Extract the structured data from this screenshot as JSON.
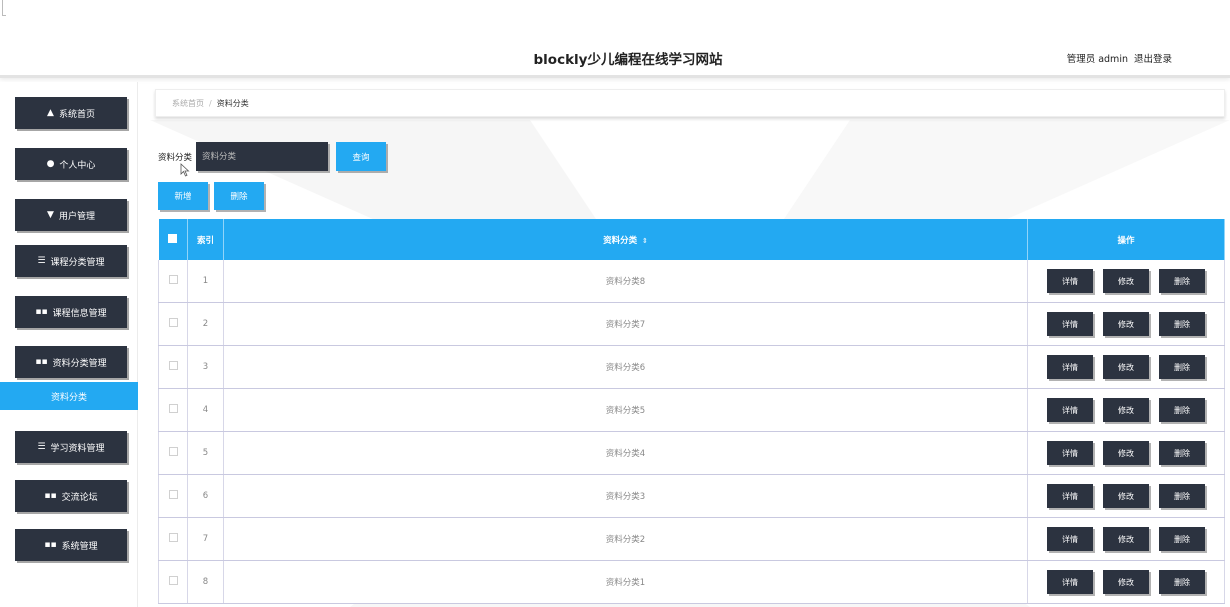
{
  "header": {
    "title": "blockly少儿编程在线学习网站",
    "user_label": "管理员 admin",
    "logout_label": "退出登录"
  },
  "sidebar": {
    "items": [
      {
        "label": "系统首页",
        "icon": "home-icon",
        "glyph": "▲"
      },
      {
        "label": "个人中心",
        "icon": "user-icon",
        "glyph": "●"
      },
      {
        "label": "用户管理",
        "icon": "user-manage-icon",
        "glyph": "▼"
      },
      {
        "label": "课程分类管理",
        "icon": "list-icon",
        "glyph": "☰"
      },
      {
        "label": "课程信息管理",
        "icon": "grid-icon",
        "glyph": "▪▪"
      },
      {
        "label": "资料分类管理",
        "icon": "grid-icon",
        "glyph": "▪▪"
      },
      {
        "label": "学习资料管理",
        "icon": "list-icon",
        "glyph": "☰"
      },
      {
        "label": "交流论坛",
        "icon": "grid-icon",
        "glyph": "▪▪"
      },
      {
        "label": "系统管理",
        "icon": "grid-icon",
        "glyph": "▪▪"
      }
    ],
    "active_sub": "资料分类"
  },
  "breadcrumb": {
    "home": "系统首页",
    "separator": "/",
    "current": "资料分类"
  },
  "search": {
    "label": "资料分类",
    "placeholder": "资料分类",
    "button": "查询"
  },
  "actions": {
    "add": "新增",
    "delete": "删除"
  },
  "table": {
    "columns": {
      "index": "索引",
      "category": "资料分类",
      "sort_glyph": "⇕",
      "ops": "操作"
    },
    "rows": [
      {
        "index": "1",
        "category": "资料分类8"
      },
      {
        "index": "2",
        "category": "资料分类7"
      },
      {
        "index": "3",
        "category": "资料分类6"
      },
      {
        "index": "4",
        "category": "资料分类5"
      },
      {
        "index": "5",
        "category": "资料分类4"
      },
      {
        "index": "6",
        "category": "资料分类3"
      },
      {
        "index": "7",
        "category": "资料分类2"
      },
      {
        "index": "8",
        "category": "资料分类1"
      }
    ],
    "row_buttons": {
      "detail": "详情",
      "edit": "修改",
      "delete": "删除"
    }
  },
  "colors": {
    "accent": "#23a9f2",
    "dark": "#2c3340"
  }
}
